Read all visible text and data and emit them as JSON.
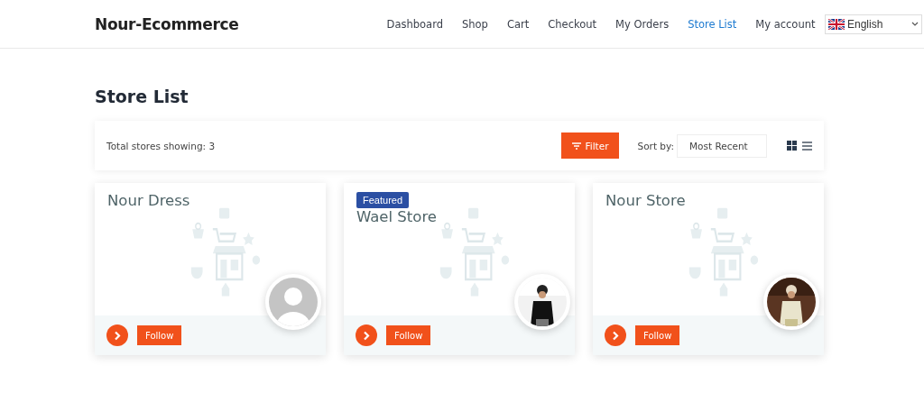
{
  "header": {
    "brand": "Nour-Ecommerce",
    "nav": [
      {
        "label": "Dashboard",
        "selected": false
      },
      {
        "label": "Shop",
        "selected": false
      },
      {
        "label": "Cart",
        "selected": false
      },
      {
        "label": "Checkout",
        "selected": false
      },
      {
        "label": "My Orders",
        "selected": false
      },
      {
        "label": "Store List",
        "selected": true
      },
      {
        "label": "My account",
        "selected": false
      }
    ],
    "language": "English"
  },
  "page_title": "Store List",
  "toolbar": {
    "total": "Total stores showing: 3",
    "filter_button": "Filter",
    "sort_label": "Sort by:",
    "sort_value": "Most Recent",
    "views": [
      {
        "kind": "grid",
        "selected": true
      },
      {
        "kind": "list",
        "selected": false
      }
    ]
  },
  "stores": [
    {
      "name": "Nour Dress",
      "featured": false,
      "avatar": {
        "kind": "default"
      },
      "follow": "Follow"
    },
    {
      "name": "Wael Store",
      "featured": true,
      "badge": "Featured",
      "follow": "Follow"
    },
    {
      "name": "Nour Store",
      "featured": false,
      "follow": "Follow"
    }
  ]
}
